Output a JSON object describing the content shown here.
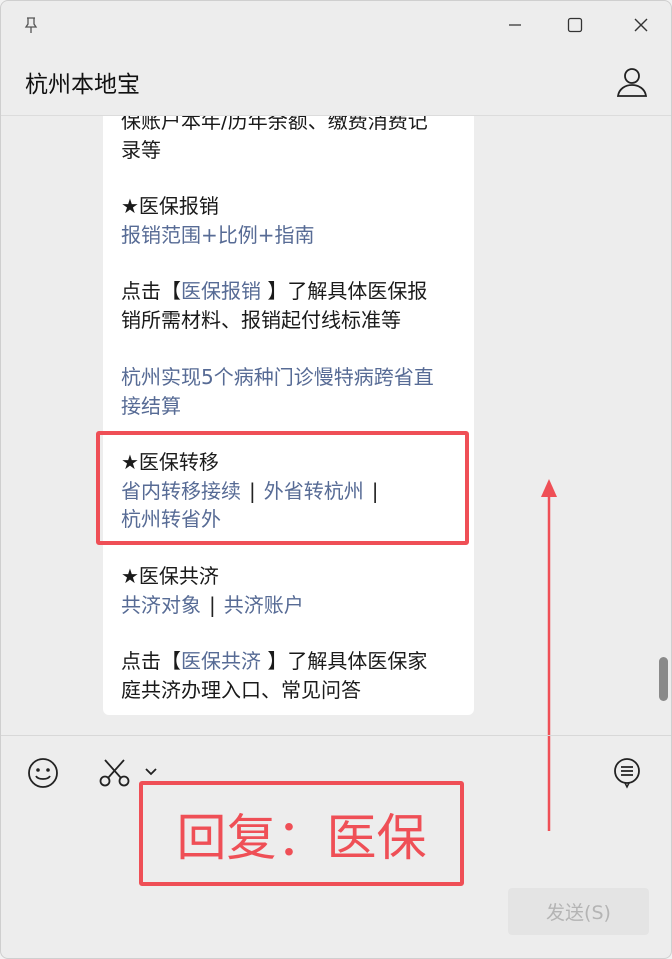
{
  "window": {
    "title": "杭州本地宝"
  },
  "message": {
    "partial_line": "保账户本年/历年余额、缴费消费记",
    "partial_line2": "录等",
    "reimburse_heading": "★医保报销",
    "reimburse_link": "报销范围+比例+指南",
    "reimburse_prefix": "点击【",
    "reimburse_keyword": "医保报销",
    "reimburse_suffix_1": " 】了解具体医保报",
    "reimburse_suffix_2": "销所需材料、报销起付线标准等",
    "news_link_1": "杭州实现5个病种门诊慢特病跨省直",
    "news_link_2": "接结算",
    "transfer_heading": "★医保转移",
    "transfer_link_1": "省内转移接续",
    "transfer_link_2": "外省转杭州",
    "transfer_link_3": "杭州转省外",
    "separator": "|",
    "mutual_heading": "★医保共济",
    "mutual_link_1": "共济对象",
    "mutual_link_2": "共济账户",
    "mutual_prefix": "点击【",
    "mutual_keyword": "医保共济",
    "mutual_suffix_1": " 】了解具体医保家",
    "mutual_suffix_2": "庭共济办理入口、常见问答"
  },
  "annotation": {
    "reply_text": "回复：医保",
    "color": "#ef4f56"
  },
  "input": {
    "send_label": "发送(S)"
  },
  "icons": [
    "pin-icon",
    "minimize-icon",
    "maximize-icon",
    "close-icon",
    "user-icon",
    "emoji-icon",
    "scissors-icon",
    "chevron-down-icon",
    "chat-history-icon",
    "arrow-up-icon"
  ]
}
